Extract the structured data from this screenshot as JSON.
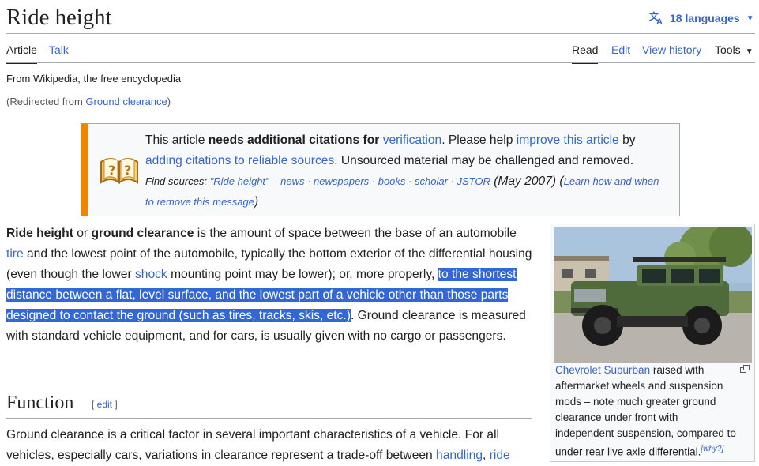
{
  "header": {
    "title": "Ride height",
    "languages_label": "18 languages"
  },
  "tabs": {
    "article": "Article",
    "talk": "Talk",
    "read": "Read",
    "edit": "Edit",
    "view_history": "View history",
    "tools": "Tools"
  },
  "tagline": "From Wikipedia, the free encyclopedia",
  "redirect": {
    "prefix": "(Redirected from ",
    "link": "Ground clearance",
    "suffix": ")"
  },
  "ambox": {
    "t1": "This article ",
    "t2_bold": "needs additional citations for ",
    "t3_link": "verification",
    "t4": ". Please help ",
    "t5_link": "improve this article",
    "t6": " by ",
    "t7_link": "adding citations to reliable sources",
    "t8": ". Unsourced material may be challenged and removed.",
    "find_label": "Find sources: ",
    "find_query": "\"Ride height\"",
    "find_dash": " – ",
    "src_news": "news",
    "src_newspapers": "newspapers",
    "src_books": "books",
    "src_scholar": "scholar",
    "src_jstor": "JSTOR",
    "sep": " · ",
    "date": " (May 2007) (",
    "learn_link": "Learn how and when to remove this message",
    "close_paren": ")"
  },
  "lead": {
    "b1": "Ride height",
    "t1": " or ",
    "b2": "ground clearance",
    "t2": " is the amount of space between the base of an automobile ",
    "l1": "tire",
    "t3": " and the lowest point of the automobile, typically the bottom exterior of the differential housing (even though the lower ",
    "l2": "shock",
    "t4": " mounting point may be lower); or, more properly, ",
    "selected": "to the shortest distance between a flat, level surface, and the lowest part of a vehicle other than those parts designed to contact the ground (such as tires, tracks, skis, etc.)",
    "t5": ". Ground clearance is measured with standard vehicle equipment, and for cars, is usually given with no cargo or passengers."
  },
  "function_section": {
    "heading": "Function",
    "edit_open": "[ ",
    "edit_link": "edit",
    "edit_close": " ]",
    "t1": "Ground clearance is a critical factor in several important characteristics of a vehicle. For all vehicles, especially cars, variations in clearance represent a trade-off between ",
    "l1": "handling",
    "t2": ", ",
    "l2": "ride"
  },
  "thumb": {
    "caption_link": "Chevrolet Suburban",
    "caption_text": " raised with aftermarket wheels and suspension mods – note much greater ground clearance under front with independent suspension, compared to under rear live axle differential.",
    "why": "[why?]"
  },
  "colors": {
    "link": "#3366cc",
    "ambox_border": "#f28500",
    "selection": "#3367d6"
  },
  "icons": [
    "translate-icon",
    "chevron-down-icon",
    "book-question-icon",
    "enlarge-icon"
  ]
}
